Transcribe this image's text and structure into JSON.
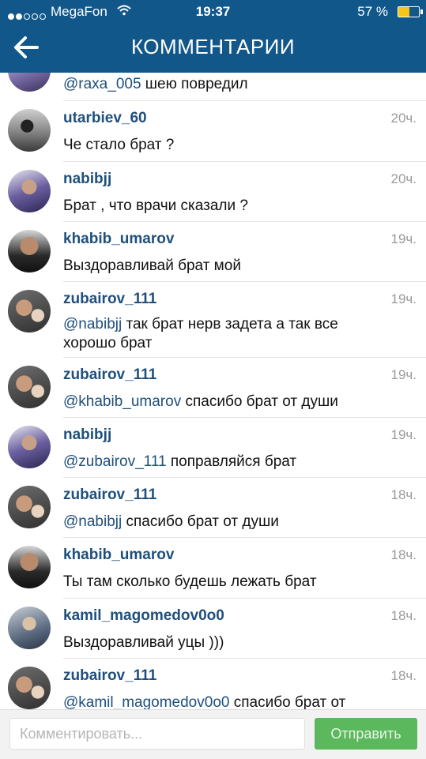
{
  "status_bar": {
    "carrier": "MegaFon",
    "time": "19:37",
    "battery": "57 %"
  },
  "header": {
    "title": "КОММЕНТАРИИ",
    "back_icon": "arrow-left-icon"
  },
  "partial_comment": {
    "mention": "@raxa_005",
    "text": " шею повредил"
  },
  "comments": [
    {
      "user": "utarbiev_60",
      "time": "20ч.",
      "mention": "",
      "text": "Че стало брат ?"
    },
    {
      "user": "nabibjj",
      "time": "20ч.",
      "mention": "",
      "text": "Брат , что врачи сказали ?"
    },
    {
      "user": "khabib_umarov",
      "time": "19ч.",
      "mention": "",
      "text": "Выздоравливай брат мой"
    },
    {
      "user": "zubairov_111",
      "time": "19ч.",
      "mention": "@nabibjj",
      "text": " так брат нерв задета а так все хорошо брат"
    },
    {
      "user": "zubairov_111",
      "time": "19ч.",
      "mention": "@khabib_umarov",
      "text": " спасибо брат от души"
    },
    {
      "user": "nabibjj",
      "time": "19ч.",
      "mention": "@zubairov_111",
      "text": " поправляйся брат"
    },
    {
      "user": "zubairov_111",
      "time": "18ч.",
      "mention": "@nabibjj",
      "text": " спасибо брат от души"
    },
    {
      "user": "khabib_umarov",
      "time": "18ч.",
      "mention": "",
      "text": "Ты там сколько будешь лежать брат"
    },
    {
      "user": "kamil_magomedov0o0",
      "time": "18ч.",
      "mention": "",
      "text": "Выздоравливай уцы )))"
    },
    {
      "user": "zubairov_111",
      "time": "18ч.",
      "mention": "@kamil_magomedov0o0",
      "text": " спасибо брат от"
    }
  ],
  "composer": {
    "placeholder": "Комментировать...",
    "send_label": "Отправить"
  }
}
